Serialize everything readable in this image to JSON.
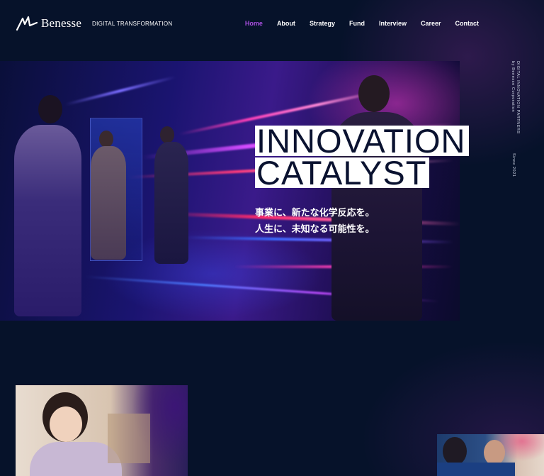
{
  "brand": {
    "logo_text": "Benesse",
    "division": "DIGITAL TRANSFORMATION"
  },
  "nav": {
    "items": [
      {
        "label": "Home",
        "active": true
      },
      {
        "label": "About"
      },
      {
        "label": "Strategy"
      },
      {
        "label": "Fund"
      },
      {
        "label": "Interview"
      },
      {
        "label": "Career"
      },
      {
        "label": "Contact"
      }
    ]
  },
  "side": {
    "line1": "DIGITAL INNOVATION PARTNERS",
    "line2": "by Benesse Corporation",
    "since": "Since 2021"
  },
  "hero": {
    "headline_line1": "INNOVATION",
    "headline_line2": "CATALYST",
    "tagline_line1": "事業に、新たな化学反応を。",
    "tagline_line2": "人生に、未知なる可能性を。"
  },
  "colors": {
    "background": "#06122a",
    "nav_active": "#a84fe0",
    "headline_bg": "#ffffff",
    "headline_text": "#0a1230"
  }
}
